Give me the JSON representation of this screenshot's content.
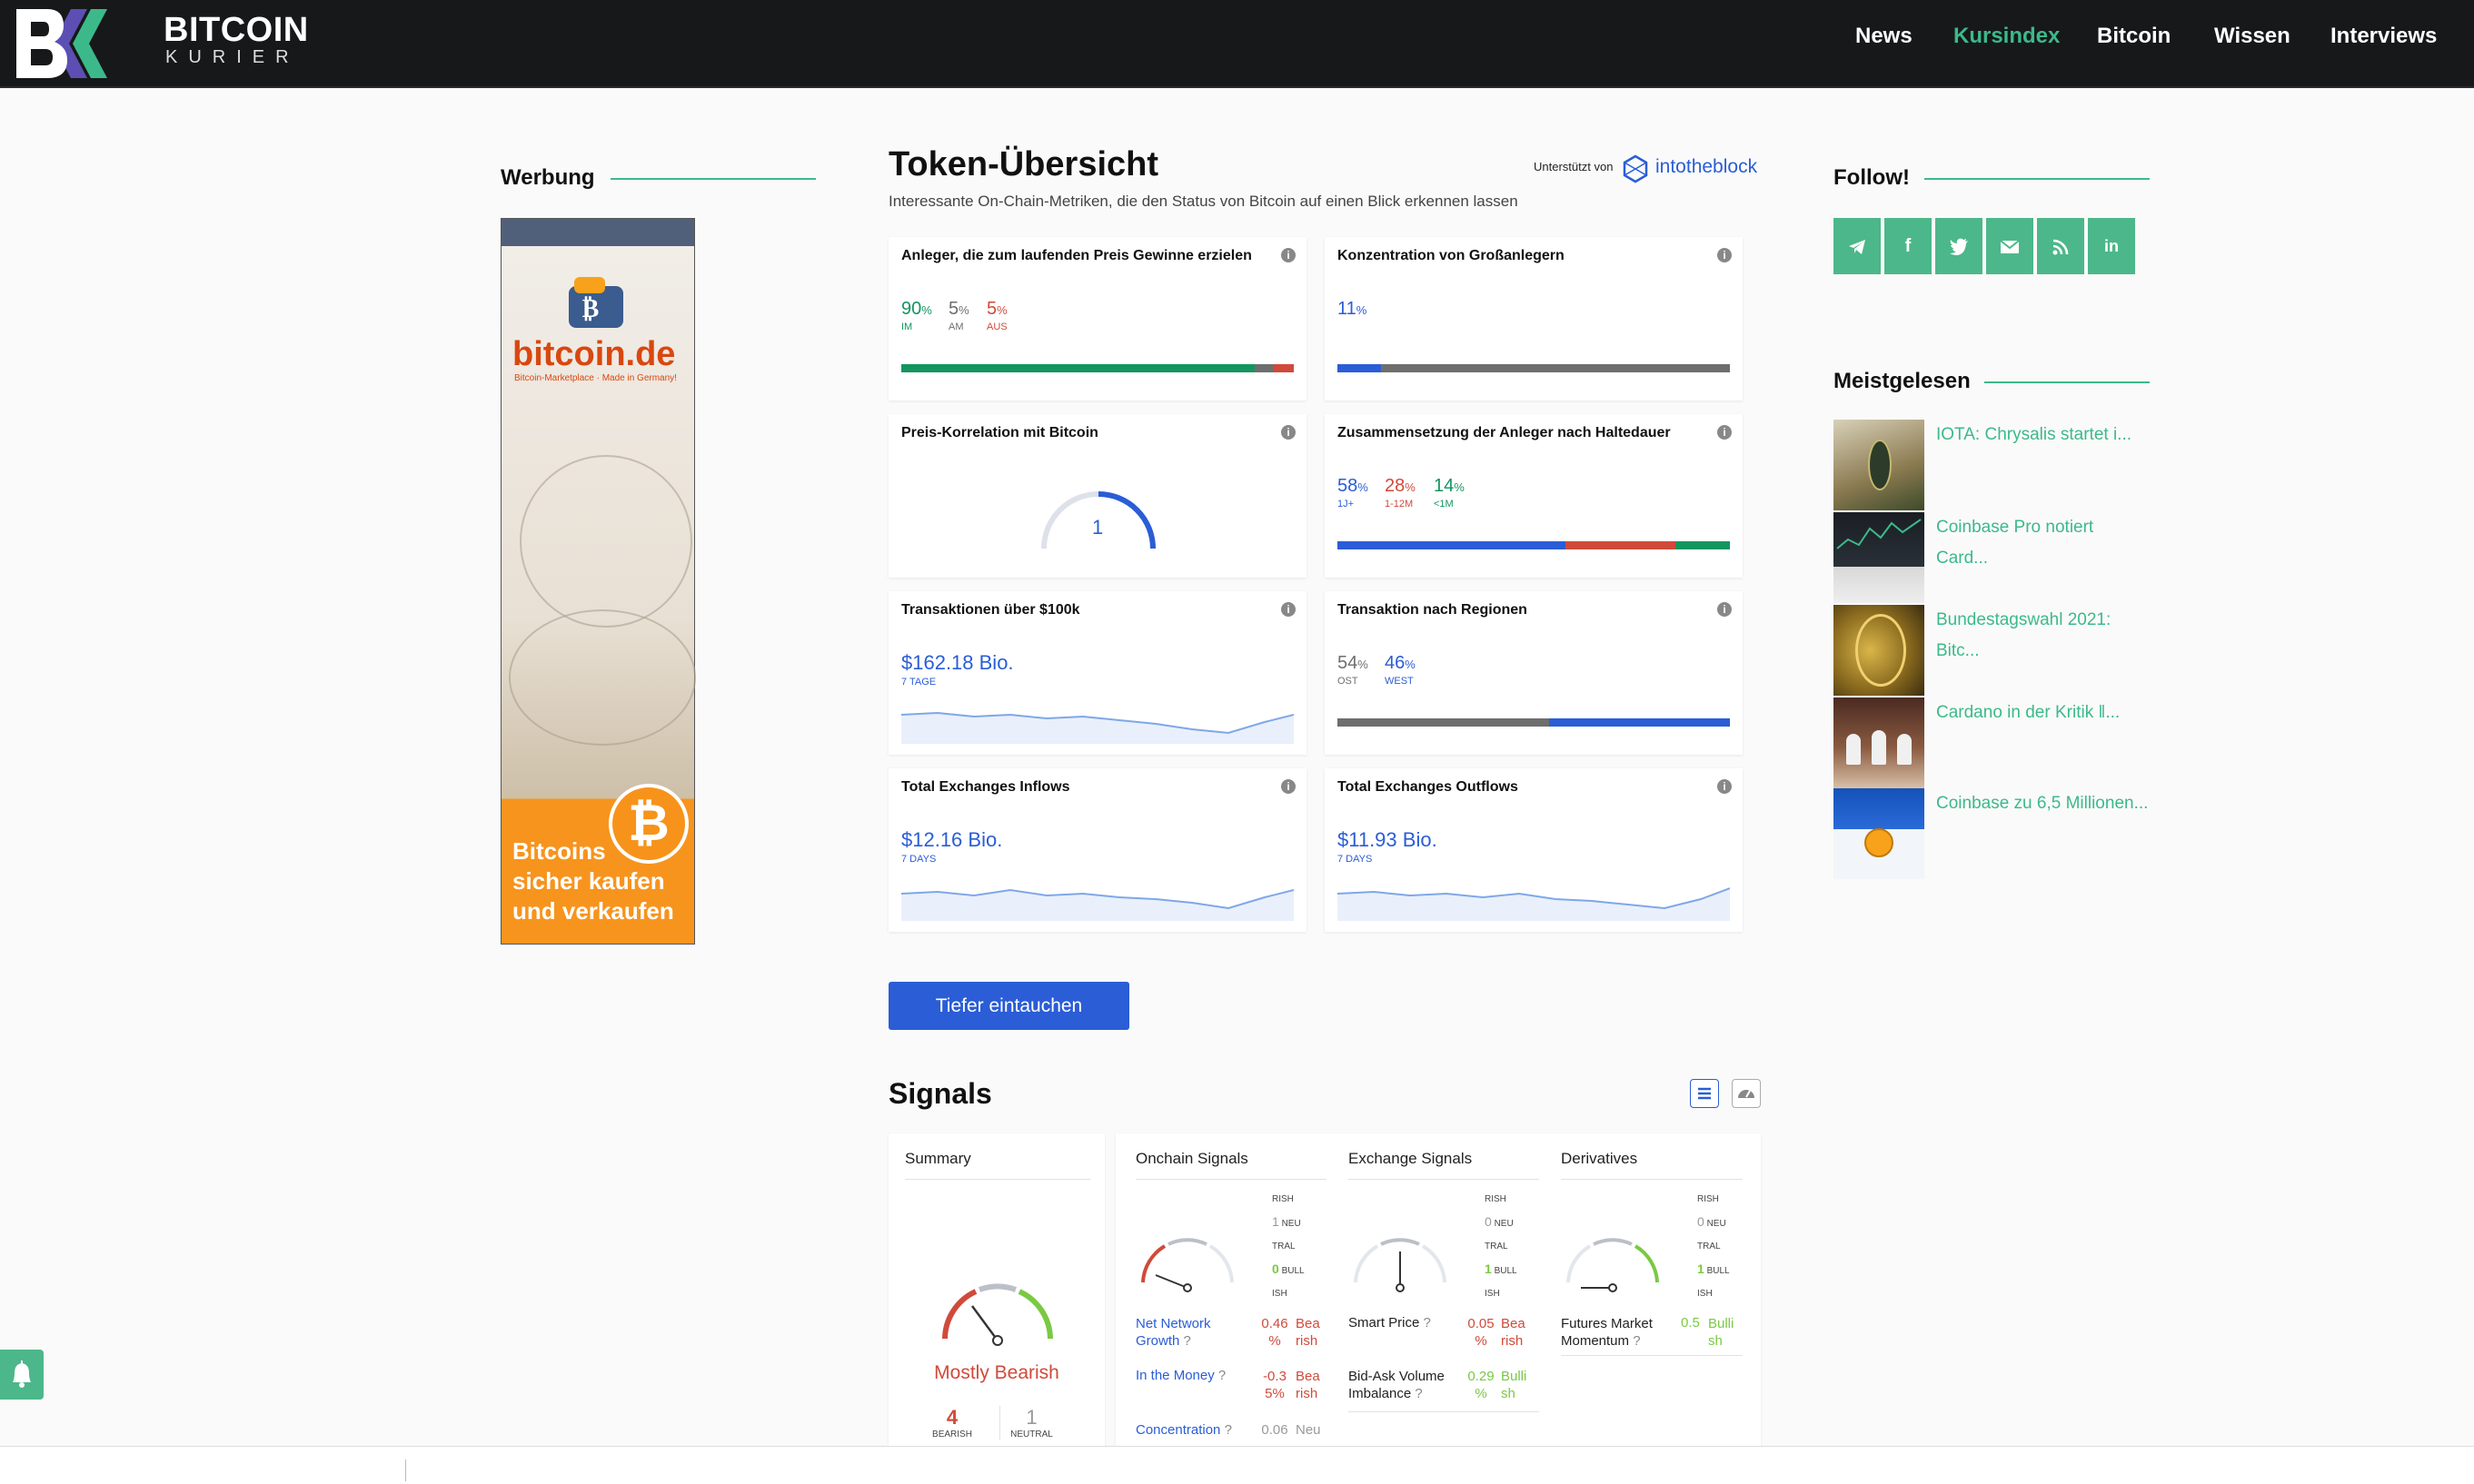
{
  "header": {
    "brand_line1": "BITCOIN",
    "brand_line2": "KURIER",
    "nav": [
      "News",
      "Kursindex",
      "Bitcoin",
      "Wissen",
      "Interviews"
    ],
    "active_nav": "Kursindex"
  },
  "left": {
    "heading": "Werbung",
    "ad": {
      "brand": "bitcoin.de",
      "tagline": "Bitcoin-Marketplace · Made in Germany!",
      "cta": [
        "Bitcoins",
        "sicher kaufen",
        "und verkaufen"
      ]
    }
  },
  "main": {
    "title": "Token-Übersicht",
    "subtitle": "Interessante On-Chain-Metriken, die den Status von Bitcoin auf einen Blick erkennen lassen",
    "powered_by": "Unterstützt von",
    "partner": "intotheblock",
    "cards": {
      "gains": {
        "title": "Anleger, die zum laufenden Preis Gewinne erzielen",
        "stats": [
          {
            "v": "90",
            "l": "IM"
          },
          {
            "v": "5",
            "l": "AM"
          },
          {
            "v": "5",
            "l": "AUS"
          }
        ]
      },
      "whales": {
        "title": "Konzentration von Großanlegern",
        "value": "11"
      },
      "correlation": {
        "title": "Preis-Korrelation mit Bitcoin",
        "value": "1"
      },
      "holding": {
        "title": "Zusammensetzung der Anleger nach Haltedauer",
        "stats": [
          {
            "v": "58",
            "l": "1J+"
          },
          {
            "v": "28",
            "l": "1-12M"
          },
          {
            "v": "14",
            "l": "<1M"
          }
        ]
      },
      "large_tx": {
        "title": "Transaktionen über $100k",
        "value": "$162.18 Bio.",
        "label": "7 TAGE"
      },
      "regions": {
        "title": "Transaktion nach Regionen",
        "stats": [
          {
            "v": "54",
            "l": "OST"
          },
          {
            "v": "46",
            "l": "WEST"
          }
        ]
      },
      "inflows": {
        "title": "Total Exchanges Inflows",
        "value": "$12.16 Bio.",
        "label": "7 DAYS"
      },
      "outflows": {
        "title": "Total Exchanges Outflows",
        "value": "$11.93 Bio.",
        "label": "7 DAYS"
      }
    },
    "percent": "%",
    "cta_button": "Tiefer eintauchen",
    "signals": {
      "title": "Signals",
      "summary": {
        "heading": "Summary",
        "verdict": "Mostly Bearish",
        "counts": [
          {
            "v": "4",
            "l": "BEARISH"
          },
          {
            "v": "1",
            "l": "NEUTRAL"
          }
        ]
      },
      "onchain": {
        "heading": "Onchain Signals",
        "counts": [
          "1",
          "0"
        ],
        "neu": "NEU",
        "tral": "TRAL",
        "bull": "BULL",
        "rish": "RISH",
        "ish": "ISH",
        "rows": [
          {
            "name": "Net Network",
            "name2": "Growth",
            "v": "0.46",
            "v2": "%",
            "s": "Bea",
            "s2": "rish"
          },
          {
            "name": "In the Money",
            "v": "-0.3",
            "v2": "5%",
            "s": "Bea",
            "s2": "rish"
          },
          {
            "name": "Concentration",
            "v": "0.06",
            "s": "Neu"
          }
        ]
      },
      "exchange": {
        "heading": "Exchange Signals",
        "counts": [
          "0",
          "1"
        ],
        "rows": [
          {
            "name": "Smart Price",
            "v": "0.05",
            "v2": "%",
            "s": "Bea",
            "s2": "rish"
          },
          {
            "name": "Bid-Ask Volume",
            "name2": "Imbalance",
            "v": "0.29",
            "v2": "%",
            "s": "Bulli",
            "s2": "sh"
          }
        ]
      },
      "derivatives": {
        "heading": "Derivatives",
        "counts": [
          "0",
          "1"
        ],
        "rows": [
          {
            "name": "Futures Market",
            "name2": "Momentum",
            "v": "0.5",
            "s": "Bulli",
            "s2": "sh"
          }
        ]
      }
    }
  },
  "right": {
    "follow_heading": "Follow!",
    "social": [
      "telegram-icon",
      "facebook-icon",
      "twitter-icon",
      "mail-icon",
      "rss-icon",
      "linkedin-icon"
    ],
    "most_read_heading": "Meistgelesen",
    "most_read": [
      {
        "l1": "IOTA: Chrysalis startet i...",
        "l2": ""
      },
      {
        "l1": "Coinbase Pro notiert",
        "l2": "Card..."
      },
      {
        "l1": "Bundestagswahl 2021:",
        "l2": "Bitc..."
      },
      {
        "l1": "Cardano in der Kritik ‖...",
        "l2": ""
      },
      {
        "l1": "Coinbase zu 6,5 Millionen...",
        "l2": ""
      }
    ]
  },
  "colors": {
    "accent": "#3cb98a",
    "blue": "#2a5dd6",
    "green": "#13955f",
    "red": "#d04a3a",
    "grey": "#6e6e6e"
  }
}
